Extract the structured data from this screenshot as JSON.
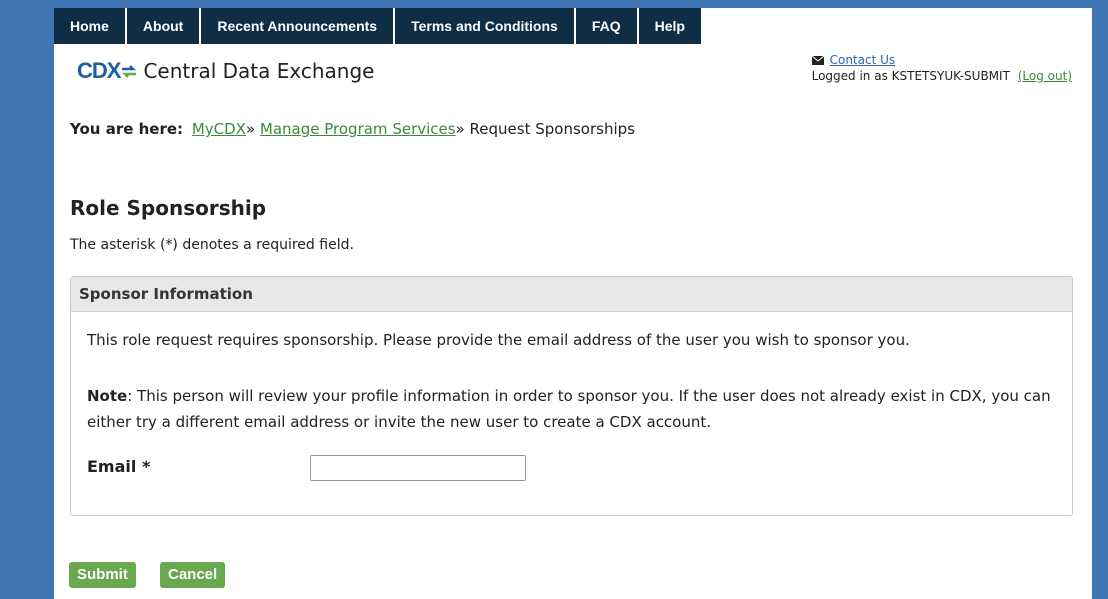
{
  "nav": {
    "items": [
      {
        "label": "Home"
      },
      {
        "label": "About"
      },
      {
        "label": "Recent Announcements"
      },
      {
        "label": "Terms and Conditions"
      },
      {
        "label": "FAQ"
      },
      {
        "label": "Help"
      }
    ]
  },
  "header": {
    "logo_mark": "CDX",
    "logo_text": "Central Data Exchange",
    "contact_label": "Contact Us",
    "logged_in_text": "Logged in as KSTETSYUK-SUBMIT",
    "logout_label": "(Log out)"
  },
  "breadcrumb": {
    "label": "You are here:",
    "items": [
      {
        "label": "MyCDX"
      },
      {
        "label": "Manage Program Services"
      },
      {
        "label": "Request Sponsorships"
      }
    ],
    "separator": "»"
  },
  "main": {
    "title": "Role Sponsorship",
    "required_note": "The asterisk (*) denotes a required field."
  },
  "panel": {
    "header": "Sponsor Information",
    "intro": "This role request requires sponsorship. Please provide the email address of the user you wish to sponsor you.",
    "note_label": "Note",
    "note_text": ": This person will review your profile information in order to sponsor you. If the user does not already exist in CDX, you can either try a different email address or invite the new user to create a CDX account.",
    "email_label": "Email *",
    "email_value": ""
  },
  "buttons": {
    "submit": "Submit",
    "cancel": "Cancel"
  },
  "colors": {
    "background": "#3f75b4",
    "nav": "#0f2e45",
    "link": "#3d8a3d",
    "button": "#6aa84f"
  }
}
